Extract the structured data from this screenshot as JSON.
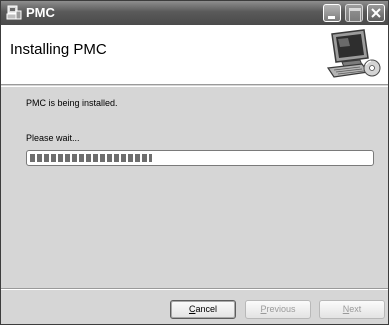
{
  "window": {
    "title": "PMC",
    "controls": [
      "minimize",
      "maximize",
      "close"
    ]
  },
  "header": {
    "title": "Installing PMC",
    "art_icon": "computer-install-icon"
  },
  "content": {
    "status": "PMC is being installed.",
    "wait_label": "Please wait...",
    "progress_percent": 36
  },
  "buttons": {
    "cancel": {
      "mnemonic": "C",
      "rest": "ancel"
    },
    "previous": {
      "mnemonic": "P",
      "rest": "revious"
    },
    "next": {
      "mnemonic": "N",
      "rest": "ext"
    }
  }
}
